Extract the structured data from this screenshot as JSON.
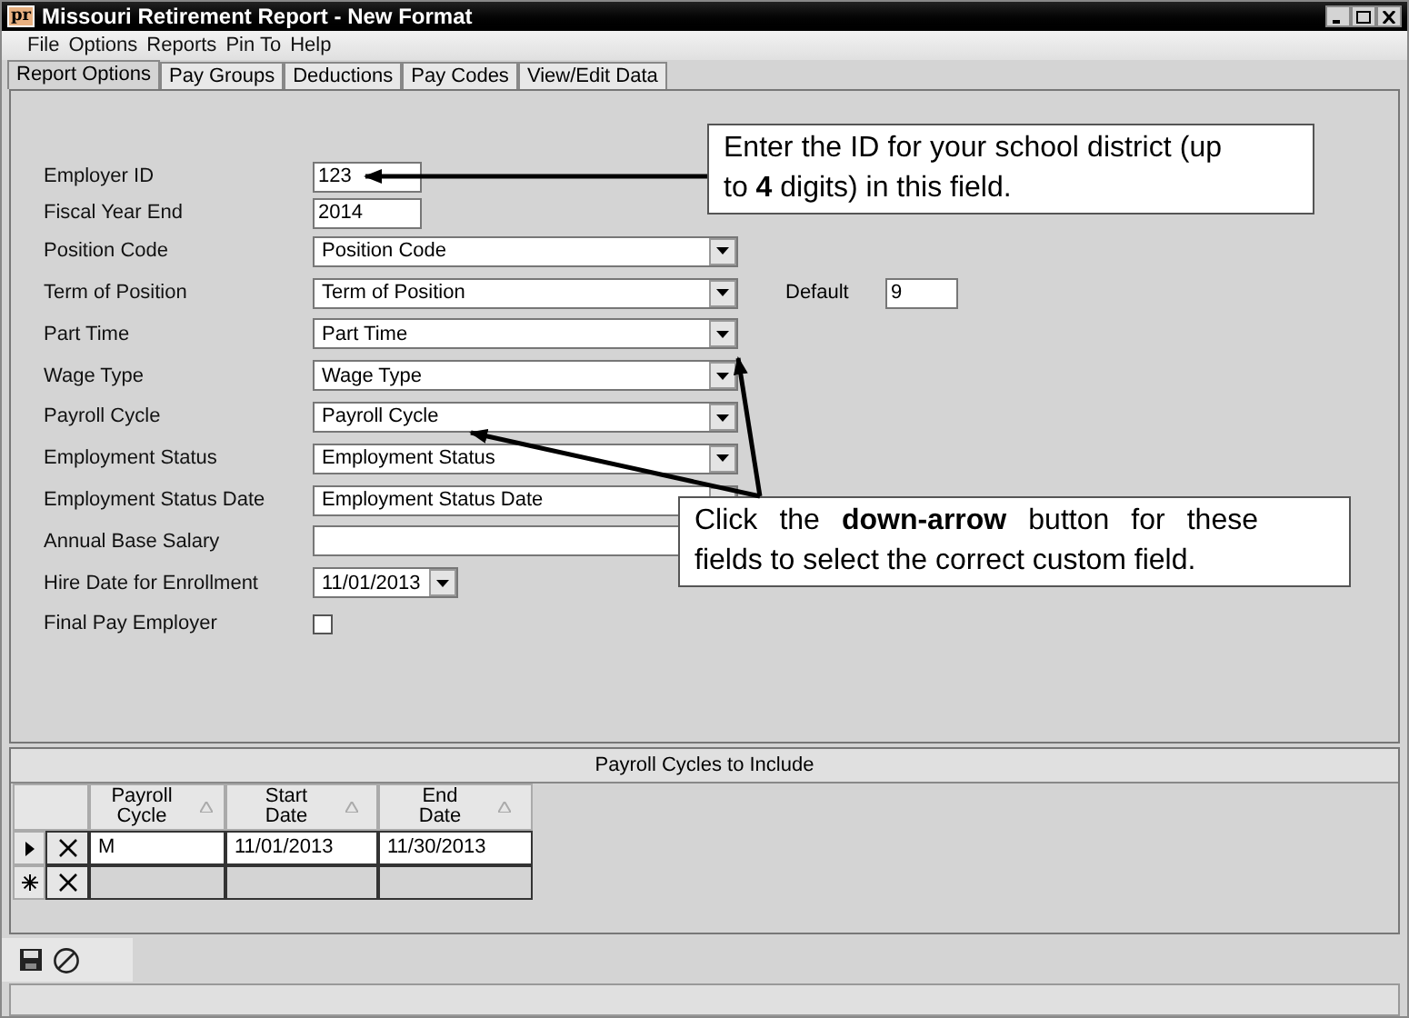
{
  "window": {
    "title": "Missouri Retirement Report - New Format",
    "app_badge": "pr"
  },
  "menu": [
    "File",
    "Options",
    "Reports",
    "Pin To",
    "Help"
  ],
  "tabs": [
    {
      "label": "Report Options",
      "selected": true
    },
    {
      "label": "Pay Groups",
      "selected": false
    },
    {
      "label": "Deductions",
      "selected": false
    },
    {
      "label": "Pay Codes",
      "selected": false
    },
    {
      "label": "View/Edit Data",
      "selected": false
    }
  ],
  "fields": [
    {
      "label": "Employer ID",
      "kind": "text",
      "value": "123"
    },
    {
      "label": "Fiscal Year End",
      "kind": "text",
      "value": "2014"
    },
    {
      "label": "Position Code",
      "kind": "dropdown",
      "value": "Position Code"
    },
    {
      "label": "Term of Position",
      "kind": "dropdown",
      "value": "Term of Position",
      "default": {
        "label": "Default",
        "value": "9"
      }
    },
    {
      "label": "Part Time",
      "kind": "dropdown",
      "value": "Part Time"
    },
    {
      "label": "Wage Type",
      "kind": "dropdown",
      "value": "Wage Type"
    },
    {
      "label": "Payroll Cycle",
      "kind": "dropdown",
      "value": "Payroll Cycle"
    },
    {
      "label": "Employment Status",
      "kind": "dropdown",
      "value": "Employment Status"
    },
    {
      "label": "Employment Status Date",
      "kind": "dropdown",
      "value": "Employment Status Date"
    },
    {
      "label": "Annual Base Salary",
      "kind": "text"
    },
    {
      "label": "Hire Date for Enrollment",
      "kind": "date",
      "value": "11/01/2013"
    },
    {
      "label": "Final Pay Employer",
      "kind": "checkbox",
      "checked": false
    }
  ],
  "grid": {
    "title": "Payroll Cycles to Include",
    "columns": [
      "Payroll Cycle",
      "Start Date",
      "End Date"
    ],
    "rows": [
      {
        "kind": "current",
        "cells": [
          "M",
          "11/01/2013",
          "11/30/2013"
        ]
      },
      {
        "kind": "new",
        "cells": []
      }
    ]
  },
  "callouts": [
    {
      "text": "Enter the ID for your school district (up to **4** digits) in this field."
    },
    {
      "text": "Click the **down-arrow**  button for these fields to select the correct custom field."
    }
  ]
}
